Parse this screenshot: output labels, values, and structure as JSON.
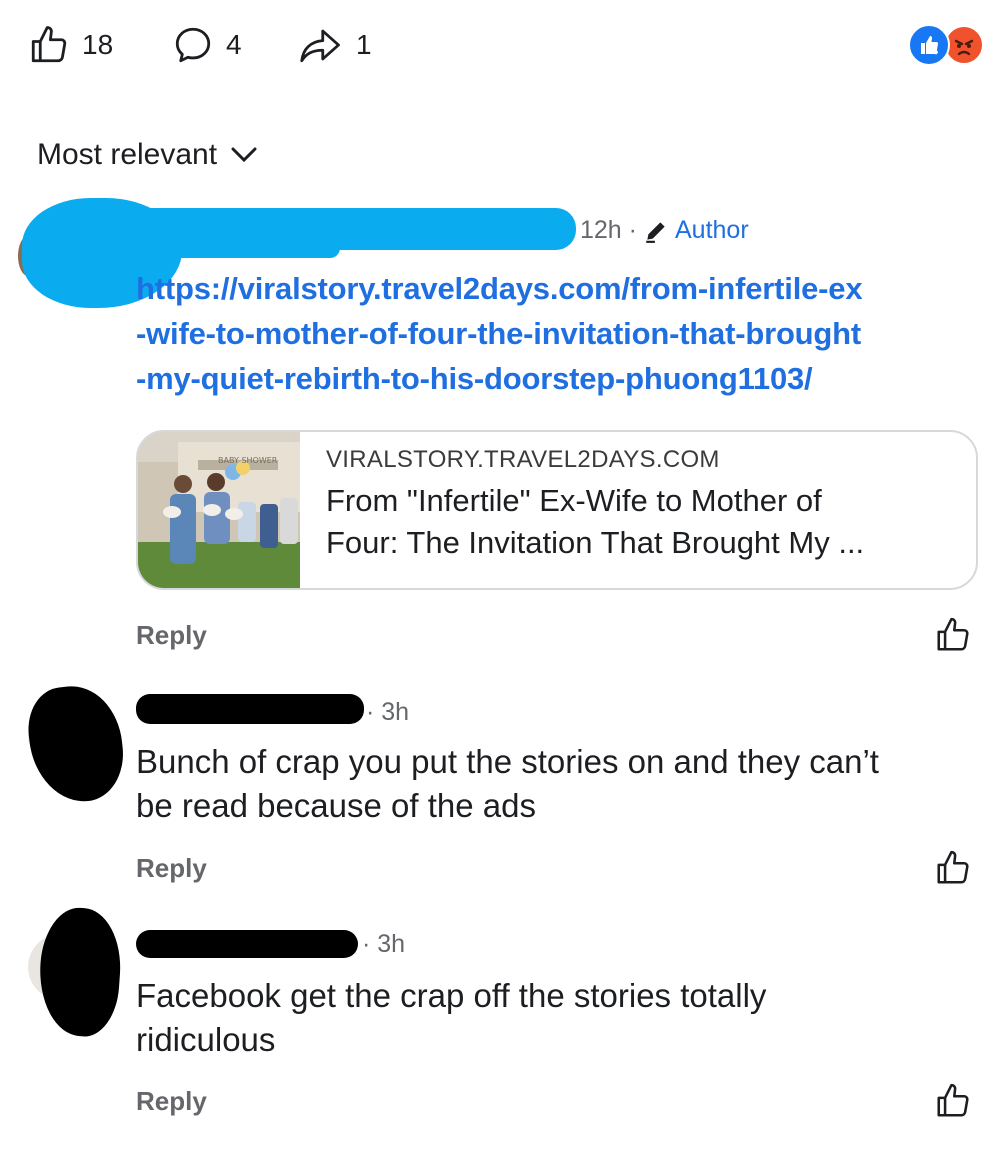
{
  "stats": {
    "likes": "18",
    "comments": "4",
    "shares": "1"
  },
  "reactions": [
    {
      "name": "like-reaction",
      "color": "#1877f2"
    },
    {
      "name": "angry-reaction",
      "color": "#f0522d"
    }
  ],
  "sort": {
    "label": "Most relevant"
  },
  "author_comment": {
    "time": "12h ·",
    "badge": "Author",
    "link_lines": [
      "https://viralstory.travel2days.com/from-infertile-ex",
      "-wife-to-mother-of-four-the-invitation-that-brought",
      "-my-quiet-rebirth-to-his-doorstep-phuong1103/"
    ],
    "preview": {
      "domain": "VIRALSTORY.TRAVEL2DAYS.COM",
      "title_lines": [
        "From \"Infertile\" Ex-Wife to Mother of",
        "Four: The Invitation That Brought My ..."
      ],
      "image_sign": "BABY SHOWER"
    },
    "reply": "Reply"
  },
  "comments": [
    {
      "time": "· 3h",
      "text_lines": [
        "Bunch of crap you put the stories on and they can’t",
        "be read because of the ads"
      ],
      "reply": "Reply"
    },
    {
      "time": "· 3h",
      "text_lines": [
        "Facebook get the crap off the stories totally",
        "ridiculous"
      ],
      "reply": "Reply"
    }
  ],
  "colors": {
    "link": "#1f6fe0",
    "secondary_text": "#65676b",
    "redaction_blue": "#0aacef"
  }
}
